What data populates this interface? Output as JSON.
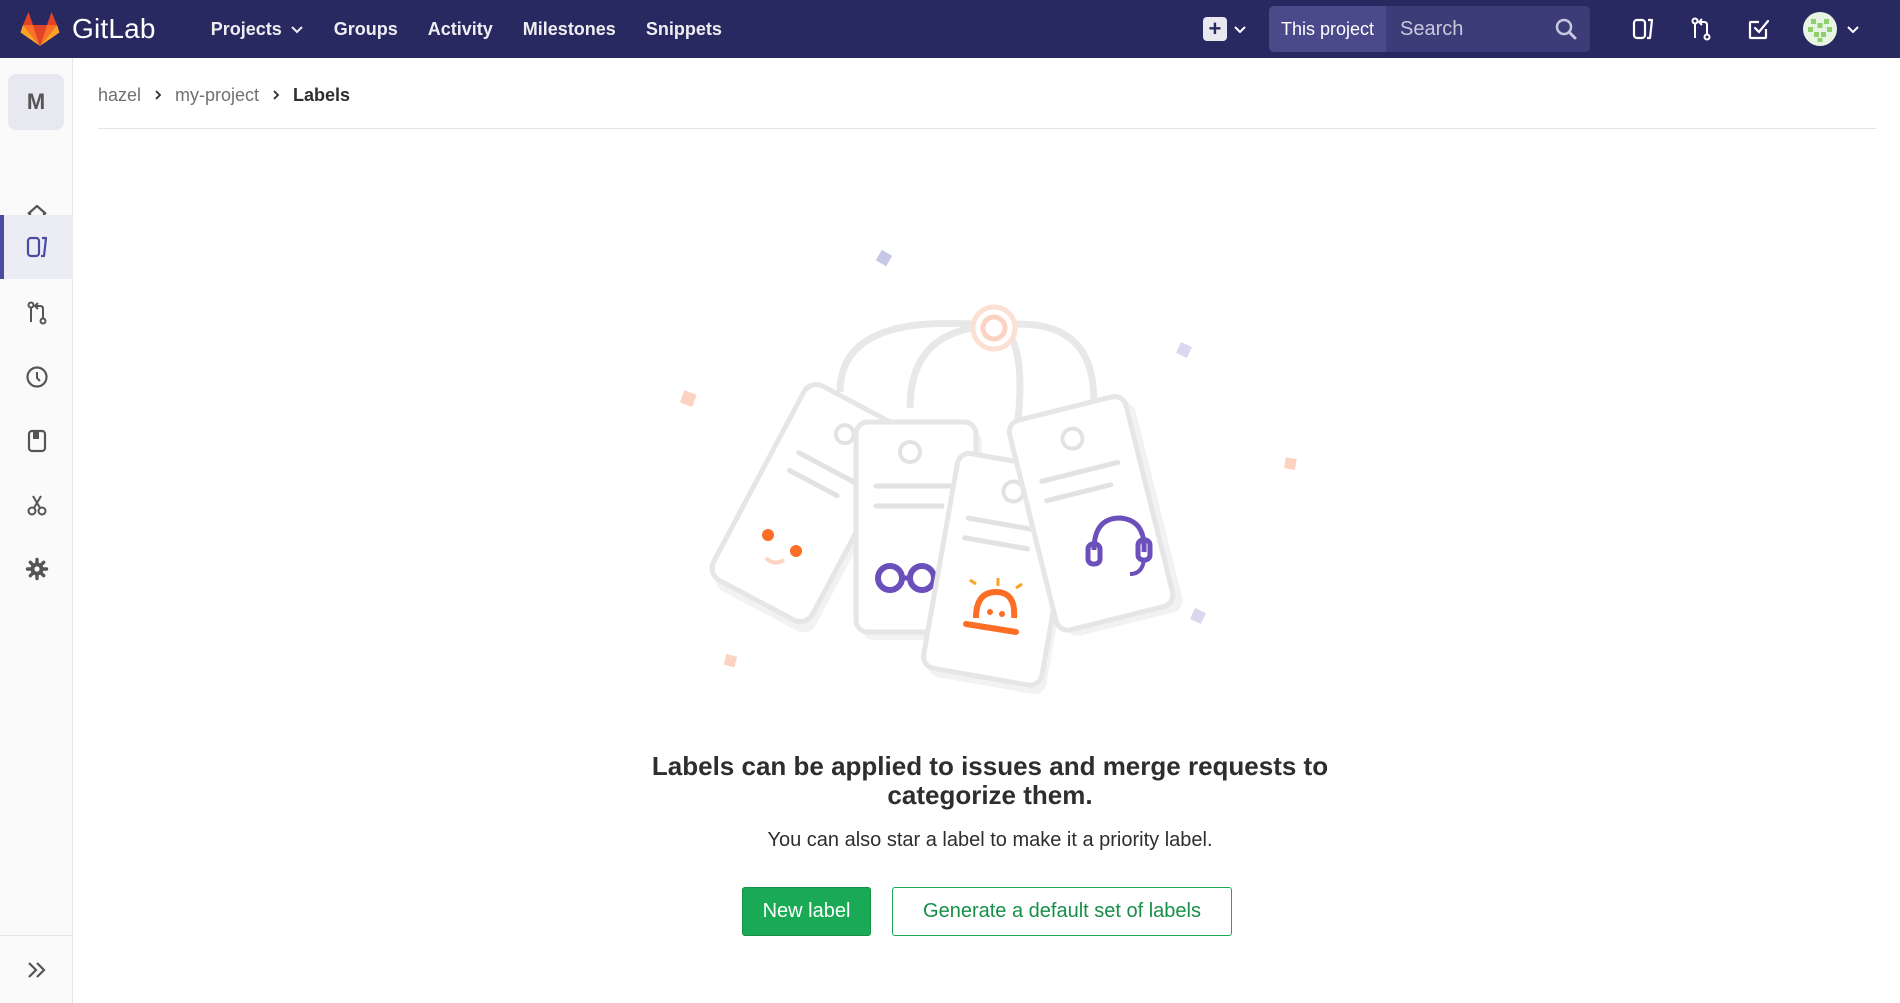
{
  "colors": {
    "navbar_bg": "#292961",
    "primary_green": "#1aaa55",
    "sidebar_active": "#4b4ba3"
  },
  "navbar": {
    "brand": "GitLab",
    "links": [
      {
        "label": "Projects",
        "has_dropdown": true
      },
      {
        "label": "Groups"
      },
      {
        "label": "Activity"
      },
      {
        "label": "Milestones"
      },
      {
        "label": "Snippets"
      }
    ],
    "search": {
      "scope": "This project",
      "placeholder": "Search"
    },
    "icons": [
      "plus-square-icon",
      "issues-icon",
      "merge-request-icon",
      "todo-icon"
    ]
  },
  "sidebar": {
    "project_letter": "M",
    "items": [
      {
        "name": "home",
        "icon": "home-icon"
      },
      {
        "name": "issues",
        "icon": "issues-icon",
        "active": true
      },
      {
        "name": "merge-requests",
        "icon": "merge-request-icon"
      },
      {
        "name": "ci-cd",
        "icon": "rocket-icon"
      },
      {
        "name": "wiki",
        "icon": "book-icon"
      },
      {
        "name": "snippets",
        "icon": "scissors-icon"
      },
      {
        "name": "settings",
        "icon": "gear-icon"
      }
    ],
    "collapse_icon": "double-chevron-right-icon"
  },
  "breadcrumb": [
    "hazel",
    "my-project",
    "Labels"
  ],
  "empty_state": {
    "title": "Labels can be applied to issues and merge requests to categorize them.",
    "subtitle": "You can also star a label to make it a priority label.",
    "primary_button": "New label",
    "secondary_button": "Generate a default set of labels"
  }
}
